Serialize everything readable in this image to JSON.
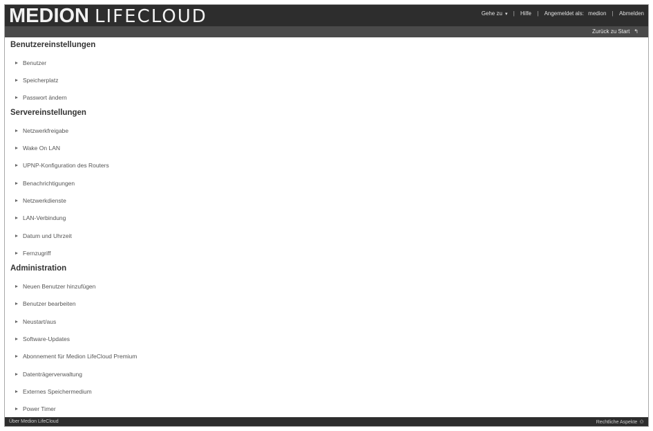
{
  "header": {
    "brand": "MEDION",
    "product": "LIFECLOUD",
    "nav": {
      "goto_label": "Gehe zu",
      "help_label": "Hilfe",
      "logged_in_label": "Angemeldet als:",
      "username": "medion",
      "logout_label": "Abmelden"
    },
    "back_label": "Zurück zu Start"
  },
  "sections": [
    {
      "title": "Benutzereinstellungen",
      "items": [
        "Benutzer",
        "Speicherplatz",
        "Passwort ändern"
      ]
    },
    {
      "title": "Servereinstellungen",
      "items": [
        "Netzwerkfreigabe",
        "Wake On LAN",
        "UPNP-Konfiguration des Routers",
        "Benachrichtigungen",
        "Netzwerkdienste",
        "LAN-Verbindung",
        "Datum und Uhrzeit",
        "Fernzugriff"
      ]
    },
    {
      "title": "Administration",
      "items": [
        "Neuen Benutzer hinzufügen",
        "Benutzer bearbeiten",
        "Neustart/aus",
        "Software-Updates",
        "Abonnement für Medion LifeCloud Premium",
        "Datenträgerverwaltung",
        "Externes Speichermedium",
        "Power Timer"
      ]
    }
  ],
  "footer": {
    "left": "Über Medion LifeCloud",
    "right": "Rechtliche Aspekte"
  }
}
